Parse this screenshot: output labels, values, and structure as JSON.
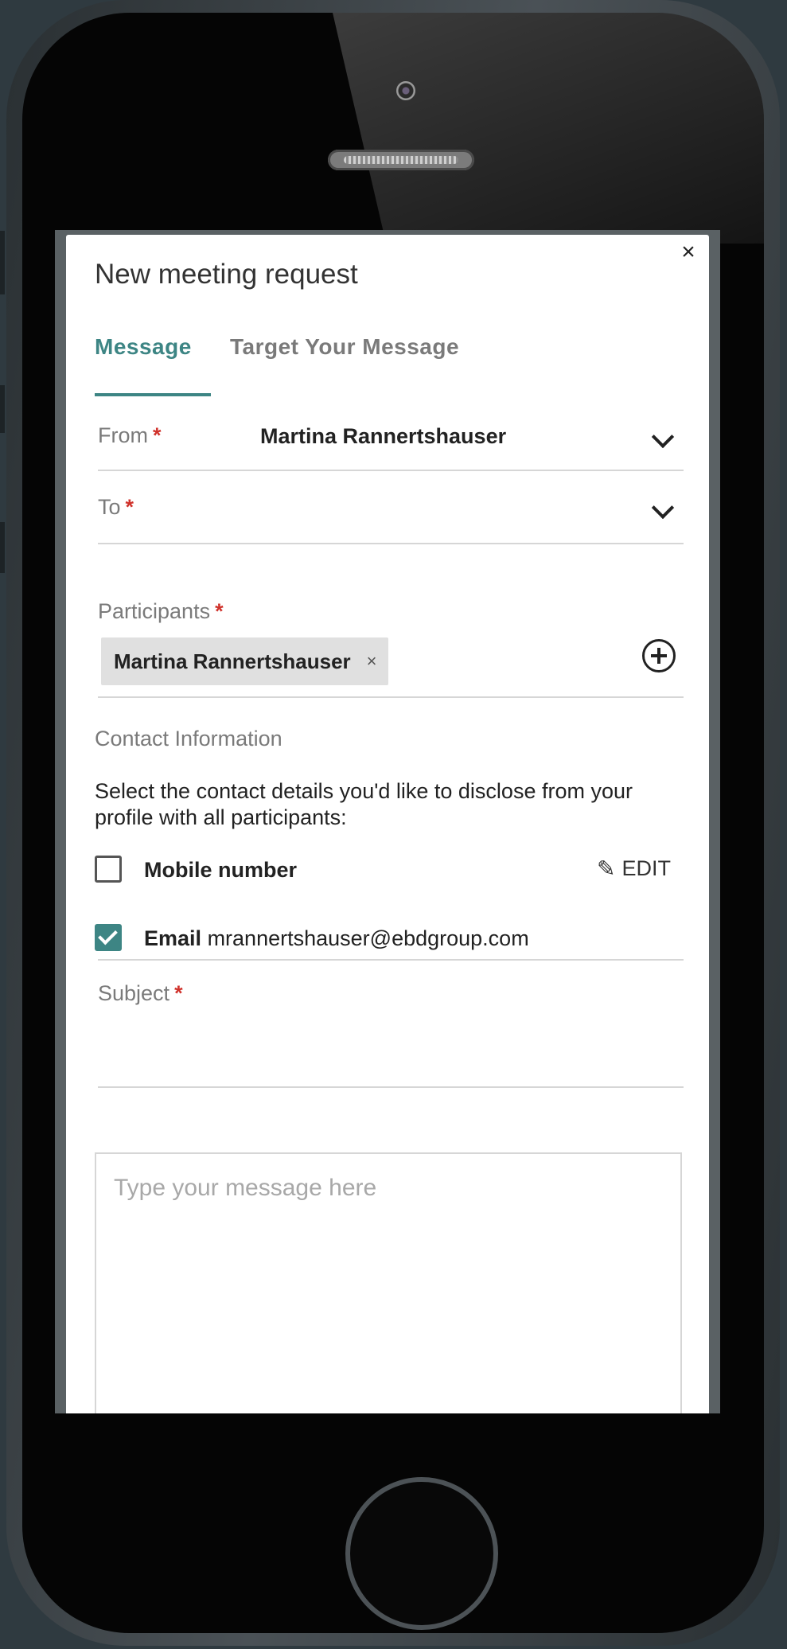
{
  "modal": {
    "title": "New meeting request",
    "close_symbol": "×"
  },
  "tabs": [
    {
      "label": "Message",
      "active": true
    },
    {
      "label": "Target Your Message",
      "active": false
    }
  ],
  "form": {
    "from": {
      "label": "From",
      "required_mark": "*",
      "value": "Martina Rannertshauser"
    },
    "to": {
      "label": "To",
      "required_mark": "*",
      "value": ""
    },
    "participants": {
      "label": "Participants",
      "required_mark": "*",
      "chips": [
        {
          "label": "Martina Rannertshauser",
          "remove_symbol": "×"
        }
      ]
    },
    "contact": {
      "section_title": "Contact Information",
      "description": "Select the contact details you'd like to disclose from your profile with all participants:",
      "mobile": {
        "label": "Mobile number",
        "checked": false,
        "edit_label": "EDIT"
      },
      "email": {
        "label": "Email",
        "value": "mrannertshauser@ebdgroup.com",
        "checked": true
      }
    },
    "subject": {
      "label": "Subject",
      "required_mark": "*",
      "value": ""
    },
    "message": {
      "placeholder": "Type your message here",
      "value": ""
    }
  },
  "colors": {
    "accent": "#3d8584",
    "required": "#d0322b"
  },
  "icons": {
    "close": "close-icon",
    "dropdown": "chevron-down-icon",
    "add": "add-circle-icon",
    "edit": "pencil-icon",
    "check": "checkmark-icon"
  }
}
